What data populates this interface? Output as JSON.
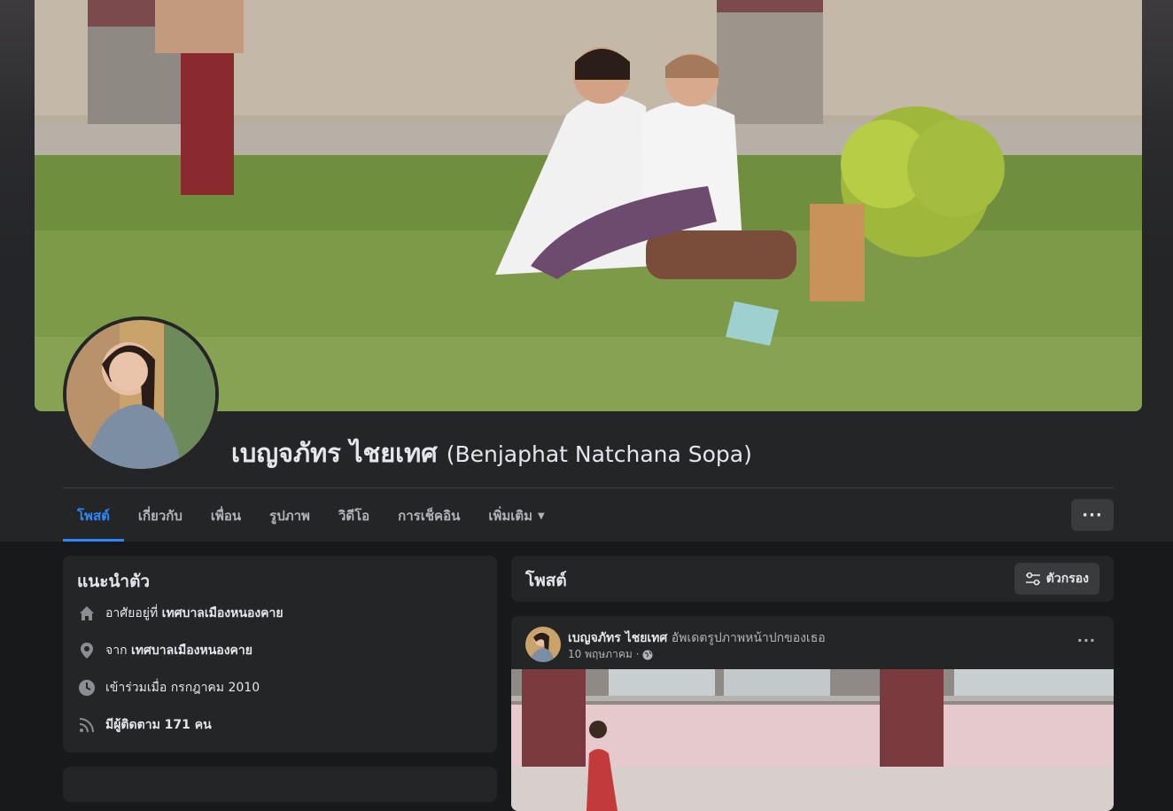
{
  "profile": {
    "name": "เบญจภัทร ไชยเทศ",
    "alt_name": "(Benjaphat Natchana Sopa)"
  },
  "tabs": [
    {
      "label": "โพสต์",
      "active": true
    },
    {
      "label": "เกี่ยวกับ"
    },
    {
      "label": "เพื่อน"
    },
    {
      "label": "รูปภาพ"
    },
    {
      "label": "วิดีโอ"
    },
    {
      "label": "การเช็คอิน"
    },
    {
      "label": "เพิ่มเติม"
    }
  ],
  "more_button": "···",
  "intro": {
    "title": "แนะนำตัว",
    "lives_prefix": "อาศัยอยู่ที่",
    "lives_value": "เทศบาลเมืองหนองคาย",
    "from_prefix": "จาก",
    "from_value": "เทศบาลเมืองหนองคาย",
    "joined": "เข้าร่วมเมื่อ กรกฎาคม 2010",
    "followers": "มีผู้ติดตาม 171 คน"
  },
  "posts_header": {
    "title": "โพสต์",
    "filter_label": "ตัวกรอง"
  },
  "post": {
    "author": "เบญจภัทร ไชยเทศ",
    "action": "อัพเดตรูปภาพหน้าปกของเธอ",
    "date": "10 พฤษภาคม ·",
    "menu": "···"
  },
  "colors": {
    "accent": "#2d88ff",
    "background": "#18191a",
    "card": "#242526",
    "button": "#3a3b3c",
    "text_primary": "#e4e6eb",
    "text_secondary": "#b0b3b8"
  },
  "icons": {
    "home": "home-icon",
    "location": "location-pin-icon",
    "clock": "clock-icon",
    "rss": "rss-icon",
    "filter": "filter-icon",
    "globe": "globe-icon",
    "caret": "caret-down-icon"
  }
}
